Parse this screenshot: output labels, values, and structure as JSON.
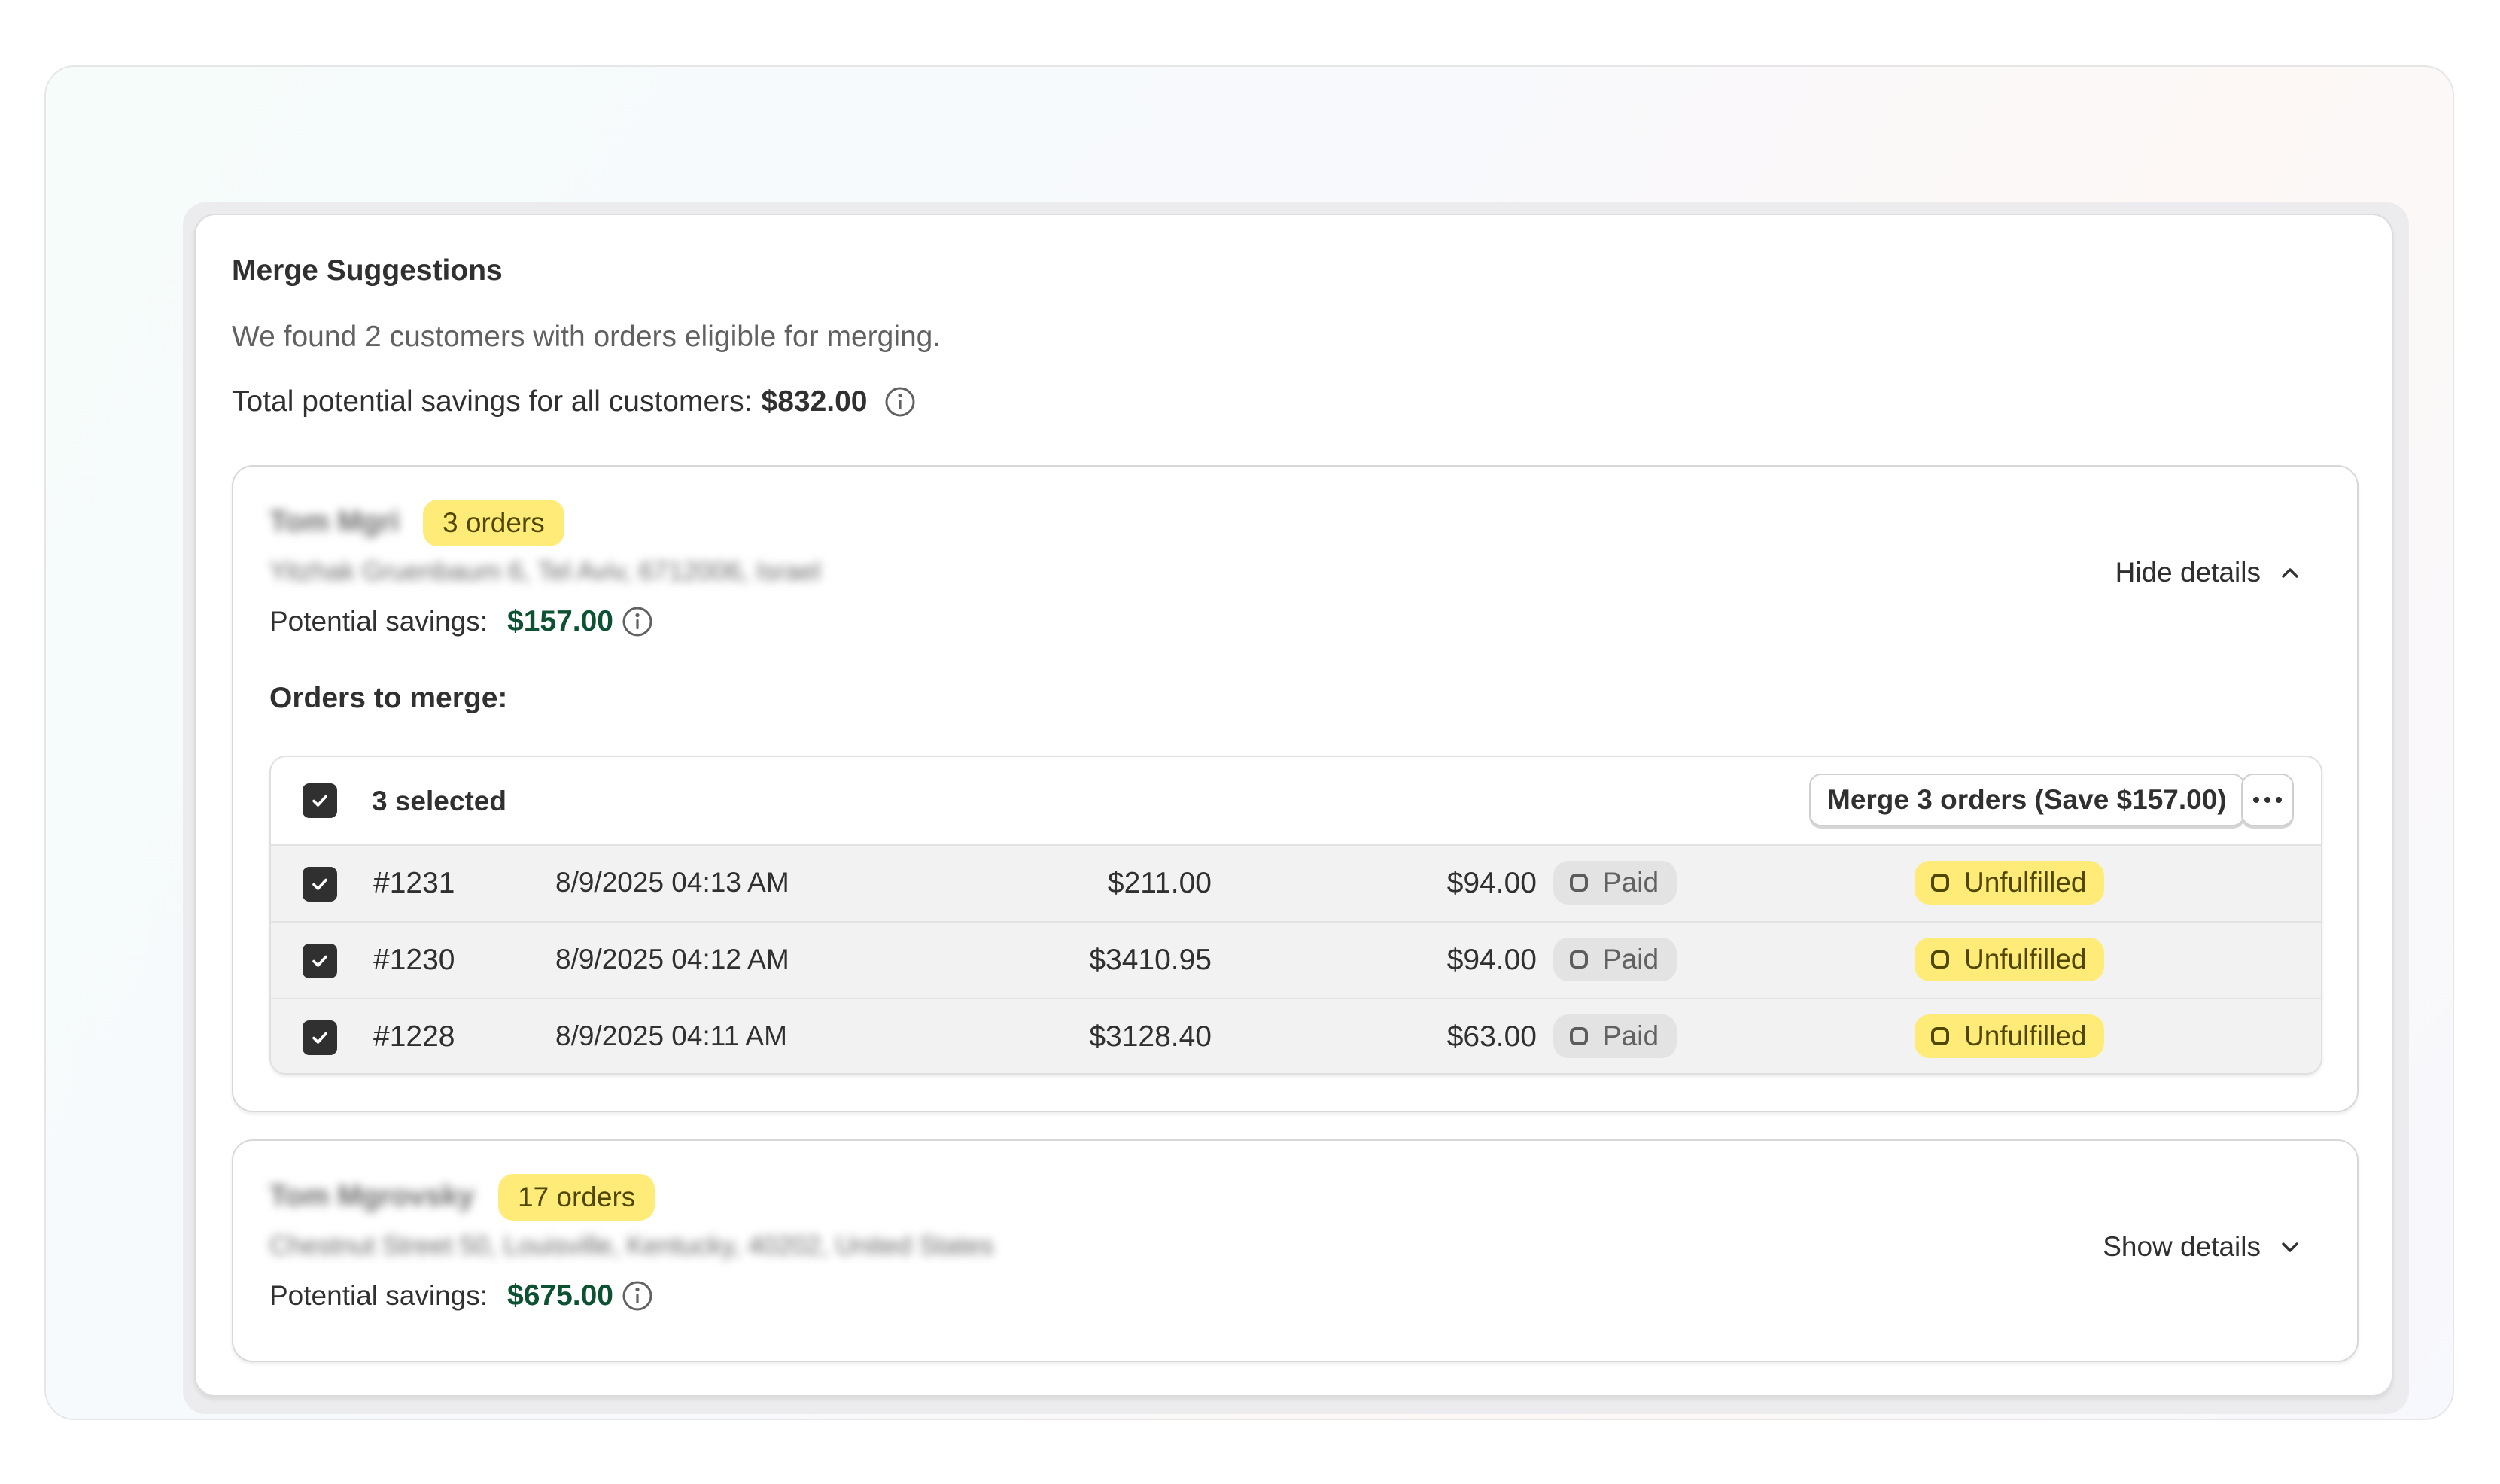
{
  "merge": {
    "title": "Merge Suggestions",
    "subtitle": "We found 2 customers with orders eligible for merging.",
    "total_label": "Total potential savings for all customers:",
    "total_value": "$832.00"
  },
  "customers": [
    {
      "name": "Tom Mgri",
      "address": "Yitzhak Gruenbaum 6, Tel Aviv, 6712006, Israel",
      "orders_badge": "3 orders",
      "savings_label": "Potential savings:",
      "savings_value": "$157.00",
      "toggle_label": "Hide details",
      "expanded": true,
      "orders_heading": "Orders to merge:",
      "selected_label": "3 selected",
      "merge_button": "Merge 3 orders (Save $157.00)",
      "orders": [
        {
          "number": "#1231",
          "date": "8/9/2025 04:13 AM",
          "total": "$211.00",
          "saving": "$94.00",
          "payment": "Paid",
          "fulfillment": "Unfulfilled",
          "checked": true
        },
        {
          "number": "#1230",
          "date": "8/9/2025 04:12 AM",
          "total": "$3410.95",
          "saving": "$94.00",
          "payment": "Paid",
          "fulfillment": "Unfulfilled",
          "checked": true
        },
        {
          "number": "#1228",
          "date": "8/9/2025 04:11 AM",
          "total": "$3128.40",
          "saving": "$63.00",
          "payment": "Paid",
          "fulfillment": "Unfulfilled",
          "checked": true
        }
      ]
    },
    {
      "name": "Tom Mgrovsky",
      "address": "Chestnut Street 50, Louisville, Kentucky, 40202, United States",
      "orders_badge": "17 orders",
      "savings_label": "Potential savings:",
      "savings_value": "$675.00",
      "toggle_label": "Show details",
      "expanded": false
    }
  ],
  "icons": {
    "info": "info-icon",
    "chevron_up": "chevron-up-icon",
    "chevron_down": "chevron-down-icon",
    "check": "checkmark-icon",
    "more": "ellipsis-icon",
    "status_ring": "status-circle-icon"
  },
  "colors": {
    "savings_green": "#0c5132",
    "badge_yellow": "#ffeb78",
    "paid_gray": "#e3e3e3",
    "checkbox_dark": "#303030"
  }
}
